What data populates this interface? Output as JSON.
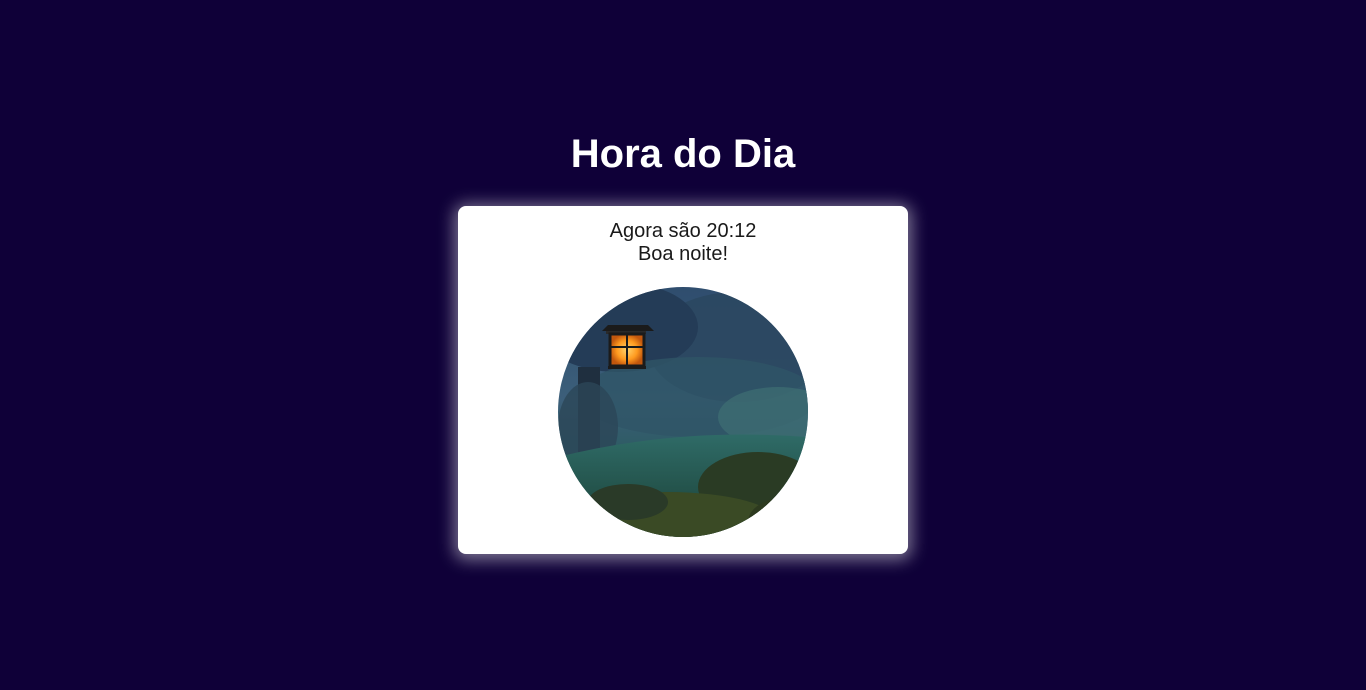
{
  "header": {
    "title": "Hora do Dia"
  },
  "card": {
    "time_text": "Agora são 20:12",
    "greeting": "Boa noite!"
  },
  "colors": {
    "background": "#0f0038",
    "card": "#ffffff",
    "lantern_glow": "#ff9a1f"
  },
  "image": {
    "subject": "night-garden-lantern-photo"
  }
}
